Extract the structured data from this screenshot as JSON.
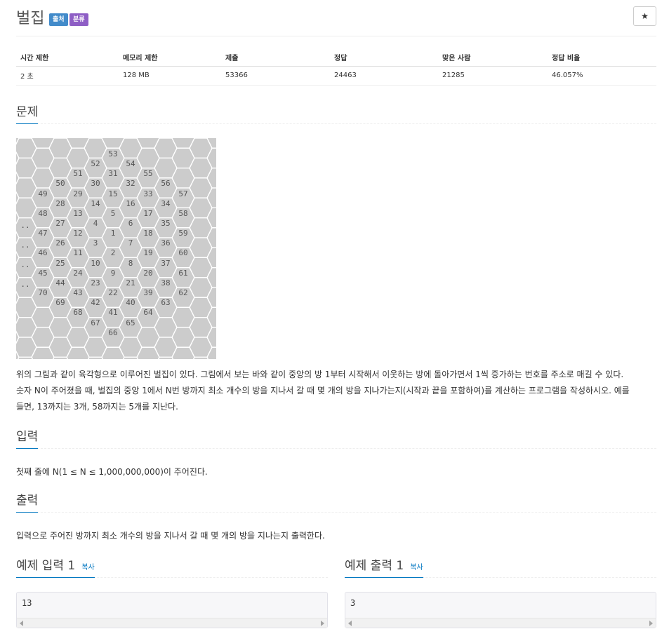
{
  "problem": {
    "title": "벌집",
    "badges": {
      "source": "출처",
      "tags": "분류"
    },
    "star_icon": "★"
  },
  "info": {
    "headers": [
      "시간 제한",
      "메모리 제한",
      "제출",
      "정답",
      "맞은 사람",
      "정답 비율"
    ],
    "values": [
      "2 초",
      "128 MB",
      "53366",
      "24463",
      "21285",
      "46.057%"
    ]
  },
  "sections": {
    "description_title": "문제",
    "input_title": "입력",
    "output_title": "출력"
  },
  "description": {
    "line1": "위의 그림과 같이 육각형으로 이루어진 벌집이 있다. 그림에서 보는 바와 같이 중앙의 방 1부터 시작해서 이웃하는 방에 돌아가면서 1씩 증가하는 번호를 주소로 매길 수 있다.",
    "line2": "숫자 N이 주어졌을 때, 벌집의 중앙 1에서 N번 방까지 최소 개수의 방을 지나서 갈 때 몇 개의 방을 지나가는지(시작과 끝을 포함하여)를 계산하는 프로그램을 작성하시오. 예를",
    "line3": "들면, 13까지는 3개, 58까지는 5개를 지난다."
  },
  "input_text": "첫째 줄에 N(1 ≤ N ≤ 1,000,000,000)이 주어진다.",
  "output_text": "입력으로 주어진 방까지 최소 개수의 방을 지나서 갈 때 몇 개의 방을 지나는지 출력한다.",
  "samples": {
    "input_title": "예제 입력 1",
    "output_title": "예제 출력 1",
    "copy_label": "복사",
    "input_value": "13",
    "output_value": "3"
  },
  "honeycomb": {
    "rooms": [
      "53",
      "52",
      "54",
      "51",
      "31",
      "55",
      "50",
      "30",
      "32",
      "56",
      "49",
      "29",
      "15",
      "33",
      "57",
      "28",
      "14",
      "16",
      "34",
      "48",
      "13",
      "5",
      "17",
      "58",
      "27",
      "4",
      "6",
      "35",
      "..",
      "47",
      "12",
      "1",
      "18",
      "59",
      "26",
      "3",
      "7",
      "36",
      "..",
      "46",
      "11",
      "2",
      "19",
      "60",
      "25",
      "10",
      "8",
      "37",
      "..",
      "45",
      "24",
      "9",
      "20",
      "61",
      "44",
      "23",
      "21",
      "38",
      "..",
      "70",
      "43",
      "22",
      "39",
      "62",
      "69",
      "42",
      "40",
      "63",
      "68",
      "41",
      "64",
      "67",
      "65",
      "66"
    ]
  }
}
